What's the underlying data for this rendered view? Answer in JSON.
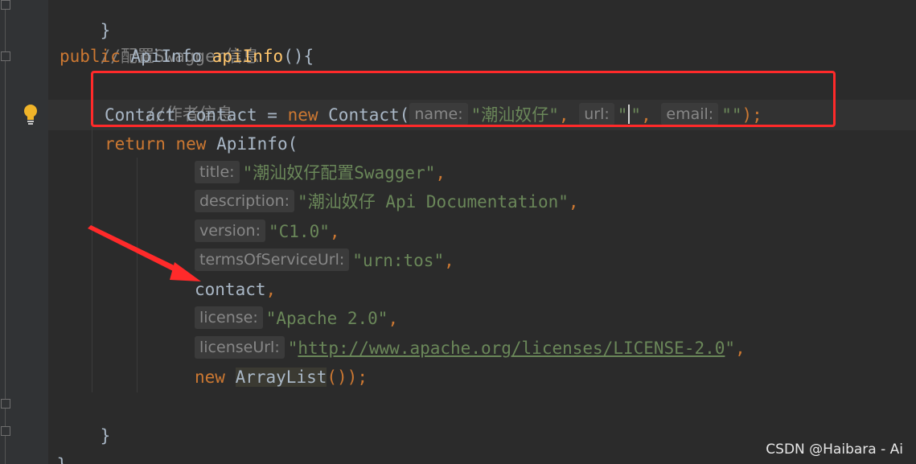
{
  "editor": {
    "lines": {
      "l0": "}",
      "l1_comment": "//配置Swagger信息",
      "l2_kw": "public",
      "l2_type": "ApiInfo",
      "l2_fn": "apiInfo",
      "l2_tail": "(){",
      "l3_comment": "//作者信息",
      "l4_type": "Contact contact = ",
      "l4_new": "new",
      "l4_cls": " Contact(",
      "l4_hint_name": "name:",
      "l4_val_name": "\"潮汕奴仔\"",
      "l4_comma1": ",",
      "l4_hint_url": "url:",
      "l4_val_url_open": "\"",
      "l4_val_url_close": "\"",
      "l4_comma2": ",",
      "l4_hint_email": "email:",
      "l4_val_email": "\"\"",
      "l4_tail": ");",
      "l5_return": "return",
      "l5_new": "new",
      "l5_cls": " ApiInfo(",
      "l6_hint": "title:",
      "l6_val": "\"潮汕奴仔配置Swagger\"",
      "l6_comma": ",",
      "l7_hint": "description:",
      "l7_val": "\"潮汕奴仔 Api Documentation\"",
      "l7_comma": ",",
      "l8_hint": "version:",
      "l8_val": "\"C1.0\"",
      "l8_comma": ",",
      "l9_hint": "termsOfServiceUrl:",
      "l9_val": "\"urn:tos\"",
      "l9_comma": ",",
      "l10_id": "contact",
      "l10_comma": ",",
      "l11_hint": "license:",
      "l11_val": "\"Apache 2.0\"",
      "l11_comma": ",",
      "l12_hint": "licenseUrl:",
      "l12_q1": "\"",
      "l12_url": "http://www.apache.org/licenses/LICENSE-2.0",
      "l12_q2": "\"",
      "l12_comma": ",",
      "l13_new": "new",
      "l13_cls": "ArrayList",
      "l13_tail": "());",
      "l14": "}",
      "l15": "}"
    }
  },
  "watermark": "CSDN @Haibara - Ai",
  "colors": {
    "background": "#2b2b2b",
    "keyword": "#cc7832",
    "string": "#6a8759",
    "method": "#ffc66d",
    "comment": "#808080",
    "annotation_box": "#ff2a2a"
  },
  "icons": [
    "lightbulb-icon",
    "fold-marker-icon",
    "red-arrow-annotation"
  ]
}
